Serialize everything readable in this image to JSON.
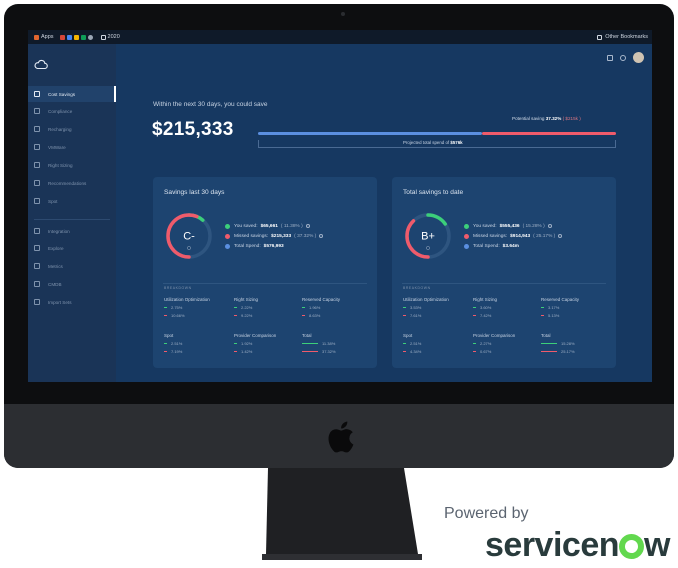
{
  "bookmarks": {
    "apps": "Apps",
    "folder": "2020",
    "other": "Other Bookmarks"
  },
  "sidebar": {
    "items": [
      {
        "label": "Cost Savings",
        "active": true
      },
      {
        "label": "Compliance"
      },
      {
        "label": "Recharging"
      },
      {
        "label": "VMWare"
      },
      {
        "label": "Right Sizing"
      },
      {
        "label": "Recommendations"
      },
      {
        "label": "Spot"
      },
      {
        "label": "Integration"
      },
      {
        "label": "Explore"
      },
      {
        "label": "Metrics"
      },
      {
        "label": "CMDB"
      },
      {
        "label": "Import Sets"
      }
    ]
  },
  "header": {
    "intro": "Within the next 30 days, you could save",
    "amount": "$215,333",
    "potential_label": "Potential saving",
    "potential_pct": "37.32%",
    "potential_amt": "( $215k )",
    "projected_label": "Projected total spend of",
    "projected_amt": "$576k",
    "saved_fraction": 0.6268
  },
  "cards": [
    {
      "title": "Savings last 30 days",
      "grade": "C-",
      "saved_fraction": 0.1138,
      "missed_fraction": 0.3732,
      "saved_label": "You saved:",
      "saved_amt": "$65,661",
      "saved_pct": "( 11.38% )",
      "missed_label": "Missed savings:",
      "missed_amt": "$215,333",
      "missed_pct": "( 37.32% )",
      "spend_label": "Total Spend:",
      "spend_amt": "$576,993",
      "breakdown_label": "BREAKDOWN",
      "breakdown": [
        {
          "name": "Utilization Optimization",
          "g": "2.75%",
          "r": "10.66%"
        },
        {
          "name": "Right Sizing",
          "g": "2.22%",
          "r": "9.22%"
        },
        {
          "name": "Reserved Capacity",
          "g": "1.96%",
          "r": "8.63%"
        },
        {
          "name": "Spot",
          "g": "2.51%",
          "r": "7.19%"
        },
        {
          "name": "Provider Comparison",
          "g": "1.92%",
          "r": "1.42%"
        },
        {
          "name": "Total",
          "g": "11.38%",
          "r": "37.32%",
          "total": true
        }
      ]
    },
    {
      "title": "Total savings to date",
      "grade": "B+",
      "saved_fraction": 0.1528,
      "missed_fraction": 0.2517,
      "saved_label": "You saved:",
      "saved_amt": "$555,436",
      "saved_pct": "( 15.28% )",
      "missed_label": "Missed savings:",
      "missed_amt": "$914,943",
      "missed_pct": "( 25.17% )",
      "spend_label": "Total Spend:",
      "spend_amt": "$3.64m",
      "breakdown_label": "BREAKDOWN",
      "breakdown": [
        {
          "name": "Utilization Optimization",
          "g": "3.53%",
          "r": "7.61%"
        },
        {
          "name": "Right Sizing",
          "g": "3.60%",
          "r": "7.42%"
        },
        {
          "name": "Reserved Capacity",
          "g": "3.17%",
          "r": "5.13%"
        },
        {
          "name": "Spot",
          "g": "2.51%",
          "r": "4.34%"
        },
        {
          "name": "Provider Comparison",
          "g": "2.27%",
          "r": "0.67%"
        },
        {
          "name": "Total",
          "g": "15.28%",
          "r": "25.17%",
          "total": true
        }
      ]
    }
  ],
  "branding": {
    "powered": "Powered by",
    "snow_a": "servicen",
    "snow_b": "w"
  },
  "colors": {
    "green": "#3ccf7a",
    "red": "#ef5b6b",
    "blue": "#5b8fe0",
    "brand_green": "#62d84e"
  }
}
